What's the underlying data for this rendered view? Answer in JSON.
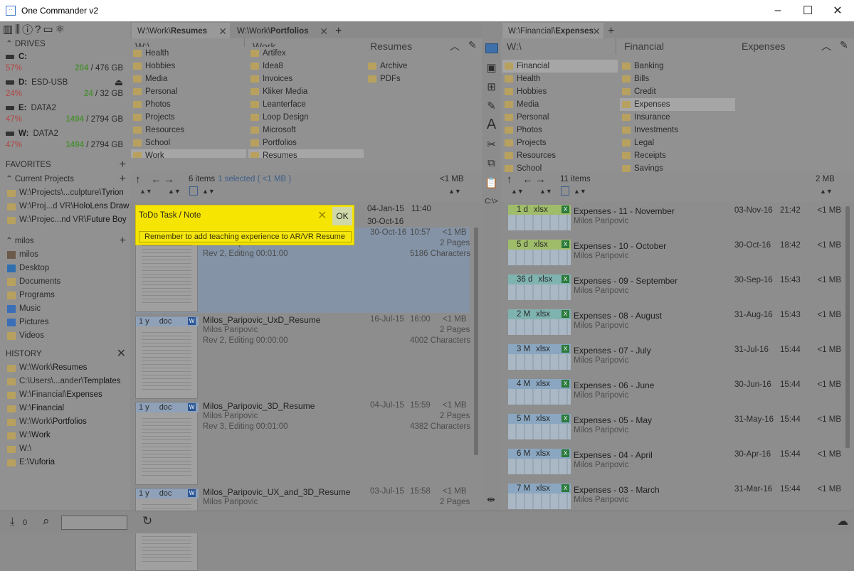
{
  "window": {
    "title": "One Commander v2",
    "app_icon_glyph": "··",
    "minimize": "–",
    "maximize": "☐",
    "close": "✕"
  },
  "sidebar": {
    "tool_icons": [
      "columns-icon",
      "sliders-icon",
      "info-icon",
      "help-icon",
      "chat-icon",
      "atom-icon"
    ],
    "drives_title": "DRIVES",
    "drives": [
      {
        "letter": "C:",
        "label": "",
        "pct": "57%",
        "free": "204",
        "total": "/ 476 GB"
      },
      {
        "letter": "D:",
        "label": "ESD-USB",
        "pct": "24%",
        "free": "24",
        "total": "/ 32 GB"
      },
      {
        "letter": "E:",
        "label": "DATA2",
        "pct": "47%",
        "free": "1494",
        "total": "/ 2794 GB"
      },
      {
        "letter": "W:",
        "label": "DATA2",
        "pct": "47%",
        "free": "1494",
        "total": "/ 2794 GB"
      }
    ],
    "favorites_title": "FAVORITES",
    "current_projects_label": "Current Projects",
    "projects": [
      {
        "pre": "W:\\Projects\\...culpture\\",
        "bold": "Tyrion"
      },
      {
        "pre": "W:\\Proj...d VR\\",
        "bold": "HoloLens Draw"
      },
      {
        "pre": "W:\\Projec...nd VR\\",
        "bold": "Future Boy"
      }
    ],
    "user_title": "milos",
    "user_items": [
      "milos",
      "Desktop",
      "Documents",
      "Programs",
      "Music",
      "Pictures",
      "Videos"
    ],
    "history_title": "HISTORY",
    "history": [
      {
        "pre": "W:\\Work\\",
        "bold": "Resumes"
      },
      {
        "pre": "C:\\Users\\...ander\\",
        "bold": "Templates"
      },
      {
        "pre": "W:\\Financial\\",
        "bold": "Expenses"
      },
      {
        "pre": "W:\\",
        "bold": "Financial"
      },
      {
        "pre": "W:\\Work\\",
        "bold": "Portfolios"
      },
      {
        "pre": "W:\\",
        "bold": "Work"
      },
      {
        "pre": "W:\\",
        "bold": ""
      },
      {
        "pre": "E:\\",
        "bold": "Vuforia"
      }
    ]
  },
  "left_pane": {
    "tabs": [
      {
        "pre": "W:\\Work\\",
        "bold": "Resumes"
      },
      {
        "pre": "W:\\Work\\",
        "bold": "Portfolios"
      }
    ],
    "col_headers": [
      "W:\\",
      "Work",
      "Resumes"
    ],
    "col1": [
      "Health",
      "Hobbies",
      "Media",
      "Personal",
      "Photos",
      "Projects",
      "Resources",
      "School",
      "Work"
    ],
    "col2": [
      "Artifex",
      "Idea8",
      "Invoices",
      "Kliker Media",
      "Leanterface",
      "Loop Design",
      "Microsoft",
      "Portfolios",
      "Resumes"
    ],
    "col3": [
      "Archive",
      "PDFs"
    ],
    "status_items": "6 items",
    "status_selected": "1 selected ( <1 MB )",
    "status_size": "<1 MB",
    "files": [
      {
        "age": "",
        "ext": "",
        "name": "",
        "author": "Milos Paripovic",
        "rev": "Rev 2, Editing 00:01:00",
        "date": "30-Oct-16",
        "time": "10:57",
        "size": "<1 MB",
        "pages": "2 Pages",
        "chars": "5186 Characters"
      },
      {
        "age": "1 y",
        "ext": "doc",
        "name": "Milos_Paripovic_UxD_Resume",
        "author": "Milos Paripovic",
        "rev": "Rev 2, Editing 00:00:00",
        "date": "16-Jul-15",
        "time": "16:00",
        "size": "<1 MB",
        "pages": "2 Pages",
        "chars": "4002 Characters"
      },
      {
        "age": "1 y",
        "ext": "doc",
        "name": "Milos_Paripovic_3D_Resume",
        "author": "Milos Paripovic",
        "rev": "Rev 3, Editing 00:01:00",
        "date": "04-Jul-15",
        "time": "15:59",
        "size": "<1 MB",
        "pages": "2 Pages",
        "chars": "4382 Characters"
      },
      {
        "age": "1 y",
        "ext": "doc",
        "name": "Milos_Paripovic_UX_and_3D_Resume",
        "author": "Milos Paripovic",
        "rev": "",
        "date": "03-Jul-15",
        "time": "15:58",
        "size": "<1 MB",
        "pages": "2 Pages",
        "chars": ""
      }
    ],
    "hidden_rows": [
      {
        "date": "04-Jan-15",
        "time": "11:40"
      },
      {
        "date": "30-Oct-16",
        "time": ""
      }
    ]
  },
  "note": {
    "title": "ToDo Task / Note",
    "ok": "OK",
    "text": "Remember to add teaching experience to AR/VR Resume"
  },
  "right_pane": {
    "tab": {
      "pre": "W:\\Financial\\",
      "bold": "Expenses"
    },
    "col_headers": [
      "W:\\",
      "Financial",
      "Expenses"
    ],
    "col1": [
      "Financial",
      "Health",
      "Hobbies",
      "Media",
      "Personal",
      "Photos",
      "Projects",
      "Resources",
      "School"
    ],
    "col2": [
      "Banking",
      "Bills",
      "Credit",
      "Expenses",
      "Insurance",
      "Investments",
      "Legal",
      "Receipts",
      "Savings"
    ],
    "status_items": "11 items",
    "status_size": "2 MB",
    "files": [
      {
        "age": "1 d",
        "ext": "xlsx",
        "name_pre": "Expenses - ",
        "name_bold": "11 - November",
        "author": "Milos Paripovic",
        "date": "03-Nov-16",
        "time": "21:42",
        "size": "<1 MB",
        "color": "#9fbc6a"
      },
      {
        "age": "5 d",
        "ext": "xlsx",
        "name_pre": "Expenses - ",
        "name_bold": "10 - October",
        "author": "Milos Paripovic",
        "date": "30-Oct-16",
        "time": "18:42",
        "size": "<1 MB",
        "color": "#9fbc6a"
      },
      {
        "age": "36 d",
        "ext": "xlsx",
        "name_pre": "Expenses - ",
        "name_bold": "09 - September",
        "author": "Milos Paripovic",
        "date": "30-Sep-16",
        "time": "15:43",
        "size": "<1 MB",
        "color": "#7fb3b0"
      },
      {
        "age": "2 M",
        "ext": "xlsx",
        "name_pre": "Expenses - ",
        "name_bold": "08 - August",
        "author": "Milos Paripovic",
        "date": "31-Aug-16",
        "time": "15:43",
        "size": "<1 MB",
        "color": "#7fb3b0"
      },
      {
        "age": "3 M",
        "ext": "xlsx",
        "name_pre": "Expenses - ",
        "name_bold": "07 - July",
        "author": "Milos Paripovic",
        "date": "31-Jul-16",
        "time": "15:44",
        "size": "<1 MB",
        "color": "#8aa6c0"
      },
      {
        "age": "4 M",
        "ext": "xlsx",
        "name_pre": "Expenses - ",
        "name_bold": "06 - June",
        "author": "Milos Paripovic",
        "date": "30-Jun-16",
        "time": "15:44",
        "size": "<1 MB",
        "color": "#8aa6c0"
      },
      {
        "age": "5 M",
        "ext": "xlsx",
        "name_pre": "Expenses - ",
        "name_bold": "05 - May",
        "author": "Milos Paripovic",
        "date": "31-May-16",
        "time": "15:44",
        "size": "<1 MB",
        "color": "#8aa6c0"
      },
      {
        "age": "6 M",
        "ext": "xlsx",
        "name_pre": "Expenses - ",
        "name_bold": "04 - April",
        "author": "Milos Paripovic",
        "date": "30-Apr-16",
        "time": "15:44",
        "size": "<1 MB",
        "color": "#8aa6c0"
      },
      {
        "age": "7 M",
        "ext": "xlsx",
        "name_pre": "Expenses - ",
        "name_bold": "03 - March",
        "author": "Milos Paripovic",
        "date": "31-Mar-16",
        "time": "15:44",
        "size": "<1 MB",
        "color": "#8aa6c0"
      }
    ]
  },
  "toolbar_mid": {
    "path_label": "C:\\>"
  },
  "bottombar": {
    "downloads_count": "0"
  }
}
